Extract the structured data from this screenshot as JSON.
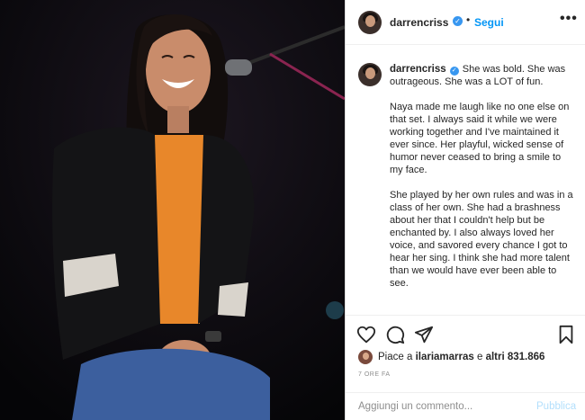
{
  "post": {
    "username": "darrencriss",
    "verified_icon": "verified-badge-icon",
    "separator": "•",
    "follow_label": "Segui",
    "more_label": "•••"
  },
  "caption": {
    "username": "darrencriss",
    "first_line": "She was bold. She was outrageous. She was a LOT of fun.",
    "paragraph_2": "Naya made me laugh like no one else on that set. I always said it while we were working together and I've maintained it ever since. Her playful, wicked sense of humor never ceased to bring a smile to my face.",
    "paragraph_3": "She played by her own rules and was in a class of her own. She had a brashness about her that I couldn't help but be enchanted by. I also always loved her voice, and savored every chance I got to hear her sing. I think she had more talent than we would have ever been able to see."
  },
  "actions": {
    "icons": [
      "heart-icon",
      "comment-icon",
      "share-icon",
      "bookmark-icon"
    ]
  },
  "likes": {
    "prefix": "Piace a ",
    "user": "ilariamarras",
    "middle": " e ",
    "rest": "altri 831.866"
  },
  "timestamp": "7 ORE FA",
  "comment": {
    "placeholder": "Aggiungi un commento...",
    "publish_label": "Pubblica"
  },
  "colors": {
    "accent": "#0095f6",
    "verified": "#3897f0",
    "publish_disabled": "#b2dffc",
    "muted": "#8e8e8e",
    "photo_bg": "#07070a"
  }
}
